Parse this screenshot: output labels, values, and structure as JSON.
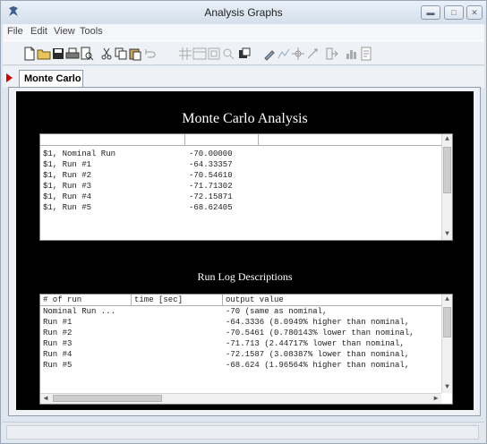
{
  "window": {
    "title": "Analysis Graphs"
  },
  "menu": [
    "File",
    "Edit",
    "View",
    "Tools"
  ],
  "toolbar": {
    "buttons": [
      "new-icon",
      "open-icon",
      "save-icon",
      "print-icon",
      "print-preview-icon",
      "cut-icon",
      "copy-icon",
      "paste-icon",
      "undo-icon",
      "grid-icon",
      "table-icon",
      "zoom-fit-icon",
      "zoom-icon",
      "window-icon",
      "brush-icon",
      "chart-icon",
      "crosshair-icon",
      "marker-icon",
      "export-icon",
      "bar-chart-icon",
      "report-icon"
    ]
  },
  "tabs": [
    {
      "label": "Monte Carlo",
      "active": true
    }
  ],
  "panel": {
    "title": "Monte Carlo Analysis",
    "runs": [
      {
        "name": "$1, Nominal Run",
        "value": "-70.00000"
      },
      {
        "name": "$1, Run #1",
        "value": "-64.33357"
      },
      {
        "name": "$1, Run #2",
        "value": "-70.54610"
      },
      {
        "name": "$1, Run #3",
        "value": "-71.71302"
      },
      {
        "name": "$1, Run #4",
        "value": "-72.15871"
      },
      {
        "name": "$1, Run #5",
        "value": "-68.62405"
      }
    ],
    "log_title": "Run Log Descriptions",
    "log_columns": [
      "# of run",
      "time [sec]",
      "output value"
    ],
    "log_rows": [
      {
        "run": "Nominal Run ...",
        "time": "",
        "output": "-70 (same as nominal,"
      },
      {
        "run": "Run #1",
        "time": "",
        "output": "-64.3336 (8.0949% higher than nominal,"
      },
      {
        "run": "Run #2",
        "time": "",
        "output": "-70.5461 (0.780143% lower than nominal,"
      },
      {
        "run": "Run #3",
        "time": "",
        "output": "-71.713 (2.44717% lower than nominal,"
      },
      {
        "run": "Run #4",
        "time": "",
        "output": "-72.1587 (3.08387% lower than nominal,"
      },
      {
        "run": "Run #5",
        "time": "",
        "output": "-68.624 (1.96564% higher than nominal,"
      }
    ]
  },
  "colors": {
    "panel_background": "#000000",
    "tab_marker": "#d40000"
  }
}
